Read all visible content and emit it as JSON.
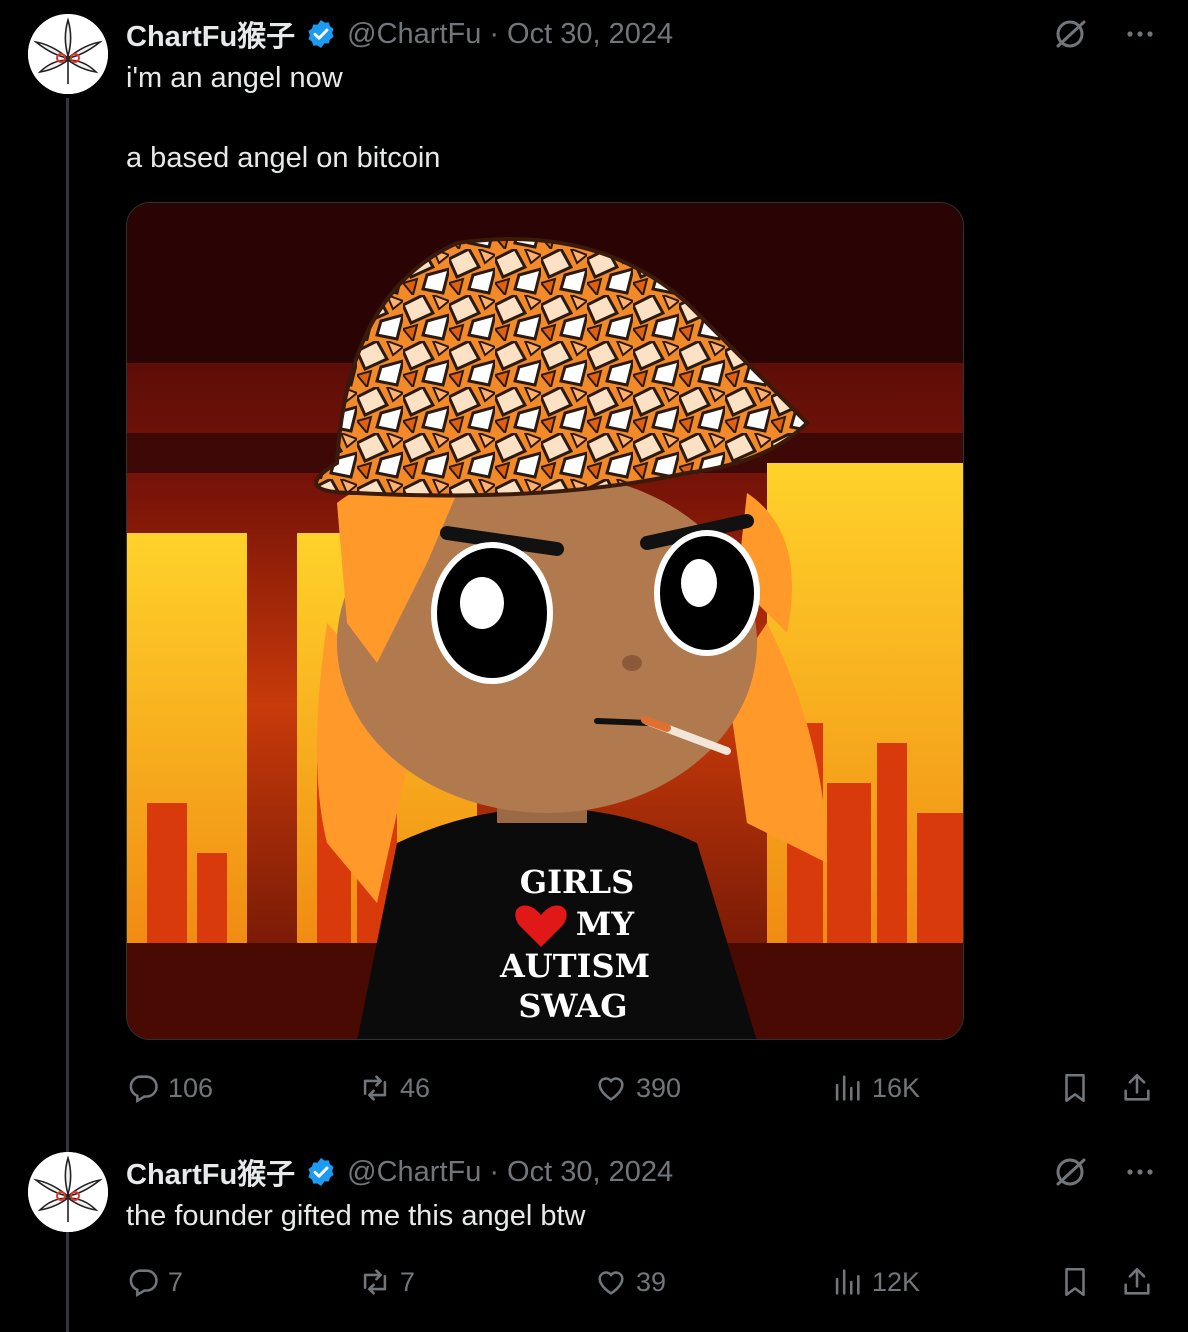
{
  "tweets": [
    {
      "author_name": "ChartFu猴子",
      "handle": "@ChartFu",
      "separator": "·",
      "date": "Oct 30, 2024",
      "text_line1": "i'm an angel now",
      "text_line2": "a based angel on bitcoin",
      "shirt_text": [
        "GIRLS",
        "MY",
        "AUTISM",
        "SWAG"
      ],
      "stats": {
        "replies": "106",
        "reposts": "46",
        "likes": "390",
        "views": "16K"
      }
    },
    {
      "author_name": "ChartFu猴子",
      "handle": "@ChartFu",
      "separator": "·",
      "date": "Oct 30, 2024",
      "text_line1": "the founder gifted me this angel btw",
      "stats": {
        "replies": "7",
        "reposts": "7",
        "likes": "39",
        "views": "12K"
      }
    }
  ],
  "colors": {
    "verified": "#1d9bf0",
    "muted": "#71767b",
    "text": "#e7e9ea"
  },
  "icons": [
    "verified-badge-icon",
    "grok-icon",
    "more-icon",
    "reply-icon",
    "repost-icon",
    "like-icon",
    "views-icon",
    "bookmark-icon",
    "share-icon"
  ]
}
